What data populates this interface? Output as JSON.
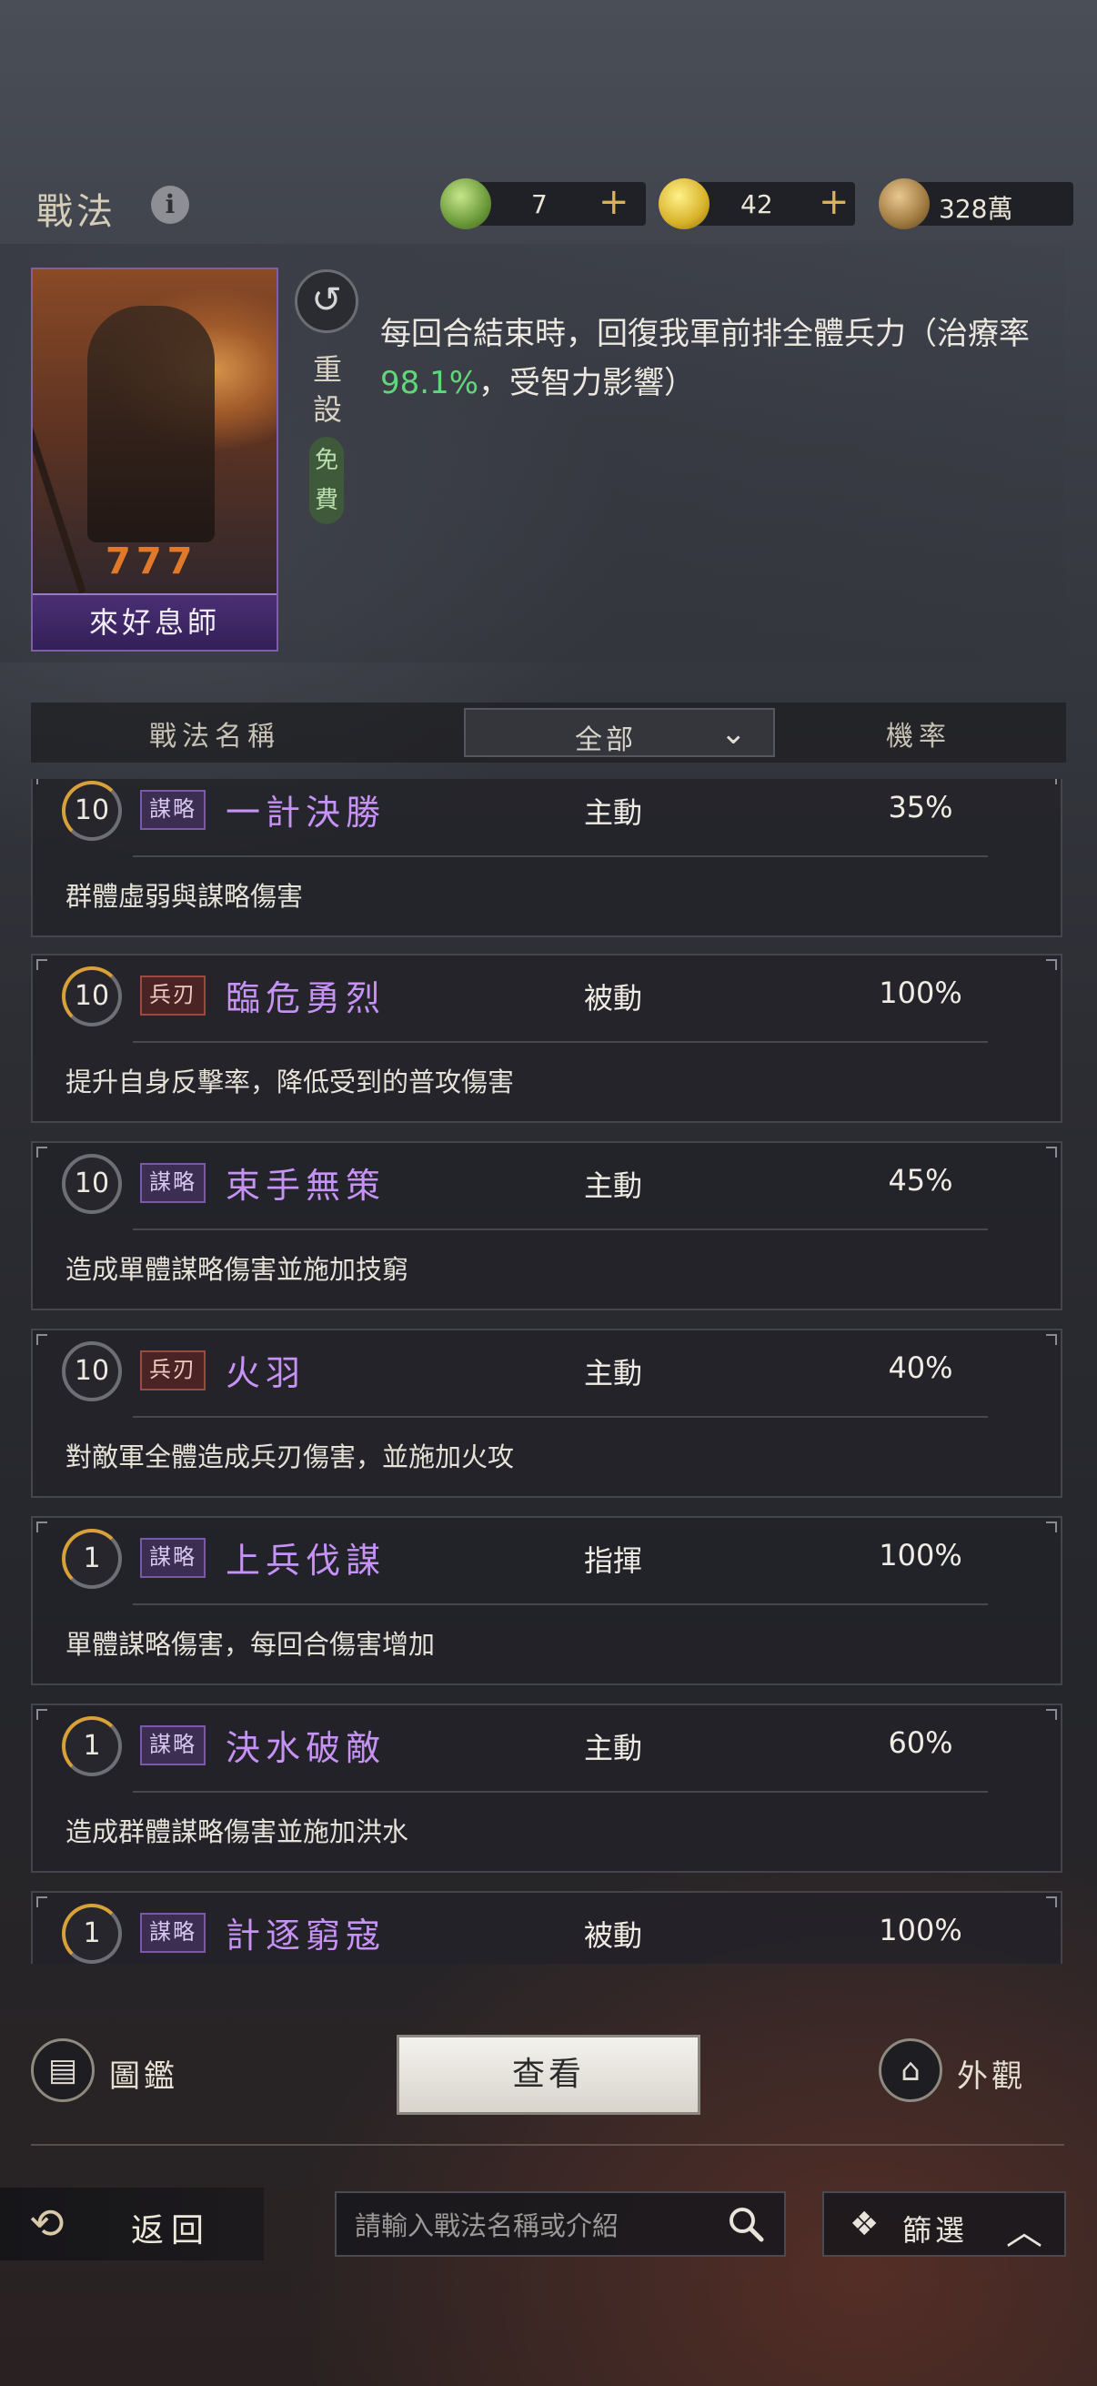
{
  "header": {
    "title": "戰法",
    "info_icon": "i",
    "resources": [
      {
        "name": "jade-coin",
        "value": "7",
        "plus": "+",
        "color": "#7fb04a"
      },
      {
        "name": "gold-coin",
        "value": "42",
        "plus": "+",
        "color": "#d8b22a"
      },
      {
        "name": "copper-coin",
        "value": "328萬",
        "color": "#b08a50"
      }
    ]
  },
  "hero": {
    "card_name": "來好息師",
    "card_marks": "777",
    "reset_label": "重設",
    "free_label": "免費",
    "desc_pre": "每回合結束時，回復我軍前排全體兵力（治療率",
    "desc_value": "98.1%",
    "desc_post": "，受智力影響）"
  },
  "list_header": {
    "name_col": "戰法名稱",
    "filter_value": "全部",
    "rate_col": "機率"
  },
  "skills": [
    {
      "level": "10",
      "tag": "謀略",
      "tag_kind": "ms",
      "name": "一計決勝",
      "type": "主動",
      "rate": "35%",
      "desc": "群體虛弱與謀略傷害"
    },
    {
      "level": "10",
      "tag": "兵刃",
      "tag_kind": "bw",
      "name": "臨危勇烈",
      "type": "被動",
      "rate": "100%",
      "desc": "提升自身反擊率，降低受到的普攻傷害"
    },
    {
      "level": "10",
      "tag": "謀略",
      "tag_kind": "ms",
      "name": "束手無策",
      "type": "主動",
      "rate": "45%",
      "desc": "造成單體謀略傷害並施加技窮"
    },
    {
      "level": "10",
      "tag": "兵刃",
      "tag_kind": "bw",
      "name": "火羽",
      "type": "主動",
      "rate": "40%",
      "desc": "對敵軍全體造成兵刃傷害，並施加火攻"
    },
    {
      "level": "1",
      "tag": "謀略",
      "tag_kind": "ms",
      "name": "上兵伐謀",
      "type": "指揮",
      "rate": "100%",
      "desc": "單體謀略傷害，每回合傷害增加"
    },
    {
      "level": "1",
      "tag": "謀略",
      "tag_kind": "ms",
      "name": "決水破敵",
      "type": "主動",
      "rate": "60%",
      "desc": "造成群體謀略傷害並施加洪水"
    },
    {
      "level": "1",
      "tag": "謀略",
      "tag_kind": "ms",
      "name": "計逐窮寇",
      "type": "被動",
      "rate": "100%",
      "desc": ""
    }
  ],
  "actions": {
    "atlas_label": "圖鑑",
    "view_label": "查看",
    "appearance_label": "外觀"
  },
  "footer": {
    "back_label": "返回",
    "search_placeholder": "請輸入戰法名稱或介紹",
    "filter_label": "篩選"
  }
}
